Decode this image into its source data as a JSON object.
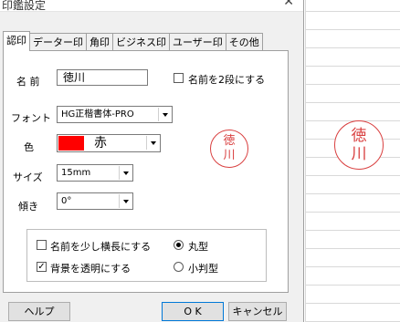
{
  "dialog": {
    "title": "印鑑設定",
    "close_glyph": "✕"
  },
  "tabs": [
    {
      "label": "認印"
    },
    {
      "label": "データー印"
    },
    {
      "label": "角印"
    },
    {
      "label": "ビジネス印"
    },
    {
      "label": "ユーザー印"
    },
    {
      "label": "その他"
    }
  ],
  "form": {
    "name_label": "名 前",
    "name_value": "徳川",
    "two_line_label": "名前を2段にする",
    "font_label": "フォント",
    "font_value": "HG正楷書体-PRO",
    "color_label": "色",
    "color_value": "赤",
    "color_swatch": "#ff0000",
    "size_label": "サイズ",
    "size_value": "15mm",
    "tilt_label": "傾き",
    "tilt_value": "0°"
  },
  "options": {
    "wide_label": "名前を少し横長にする",
    "wide_checked": false,
    "transparent_label": "背景を透明にする",
    "transparent_checked": true,
    "round_label": "丸型",
    "oval_label": "小判型",
    "selected_shape": "丸型"
  },
  "preview": {
    "line1": "徳",
    "line2": "川",
    "stamp_color": "#d94040"
  },
  "buttons": {
    "help": "ヘルプ",
    "ok": "O K",
    "cancel": "キャンセル"
  },
  "sheet_stamp": {
    "line1": "徳",
    "line2": "川"
  }
}
